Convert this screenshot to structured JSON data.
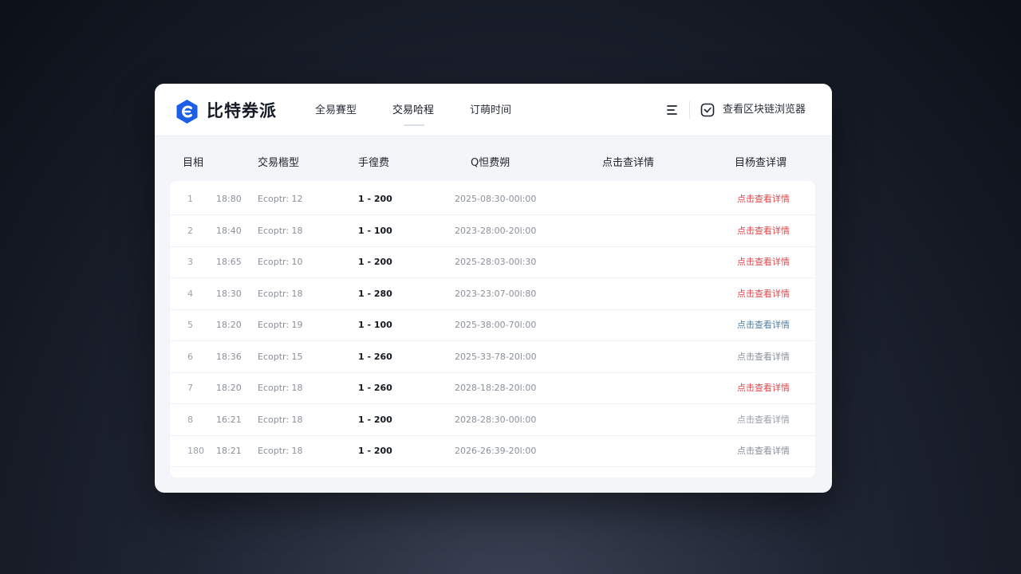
{
  "app": {
    "brand": "比特券派"
  },
  "nav": [
    {
      "label": "全易賽型"
    },
    {
      "label": "交易哈程"
    },
    {
      "label": "订萌时间"
    }
  ],
  "toolbar": {
    "explorer_label": "查看区块链浏览器"
  },
  "table": {
    "headers": [
      "目相",
      "交易楷型",
      "手徨费",
      "Q怛费朔",
      "点击查详情",
      "目杨查详谓"
    ],
    "rows": [
      {
        "idx": "1",
        "time": "18:80",
        "type": "Ecoptr: 12",
        "fee": "1 - 200",
        "date": "2025-08:30-00l:00",
        "link": "点击查看详情",
        "link_color": "#e0474c"
      },
      {
        "idx": "2",
        "time": "18:40",
        "type": "Ecoptr: 18",
        "fee": "1 - 100",
        "date": "2023-28:00-20l:00",
        "link": "点击查看详情",
        "link_color": "#e0474c"
      },
      {
        "idx": "3",
        "time": "18:65",
        "type": "Ecoptr: 10",
        "fee": "1 - 200",
        "date": "2025-28:03-00l:30",
        "link": "点击查看详情",
        "link_color": "#e0474c"
      },
      {
        "idx": "4",
        "time": "18:30",
        "type": "Ecoptr: 18",
        "fee": "1 - 280",
        "date": "2023-23:07-00l:80",
        "link": "点击查看详情",
        "link_color": "#e0474c"
      },
      {
        "idx": "5",
        "time": "18:20",
        "type": "Ecoptr: 19",
        "fee": "1 - 100",
        "date": "2025-38:00-70l:00",
        "link": "点击查看详情",
        "link_color": "#4f7fa6"
      },
      {
        "idx": "6",
        "time": "18:36",
        "type": "Ecoptr: 15",
        "fee": "1 - 260",
        "date": "2025-33-78-20l:00",
        "link": "点击查看详情",
        "link_color": "#8a909a"
      },
      {
        "idx": "7",
        "time": "18:20",
        "type": "Ecoptr: 18",
        "fee": "1 - 260",
        "date": "2028-18:28-20l:00",
        "link": "点击查看详情",
        "link_color": "#e0474c"
      },
      {
        "idx": "8",
        "time": "16:21",
        "type": "Ecoptr: 18",
        "fee": "1 - 200",
        "date": "2028-28:30-00l:00",
        "link": "点击查看详情",
        "link_color": "#9aa0aa"
      },
      {
        "idx": "180",
        "time": "18:21",
        "type": "Ecoptr: 18",
        "fee": "1 - 200",
        "date": "2026-26:39-20l:00",
        "link": "点击查看详情",
        "link_color": "#8a909a"
      }
    ]
  },
  "colors": {
    "brand": "#1d5ee6",
    "danger_link": "#e0474c",
    "info_link": "#4f7fa6",
    "muted_link": "#8a909a"
  },
  "icons": {
    "logo": "brand-hexagon-icon",
    "menu": "menu-icon",
    "explorer": "explorer-icon"
  }
}
